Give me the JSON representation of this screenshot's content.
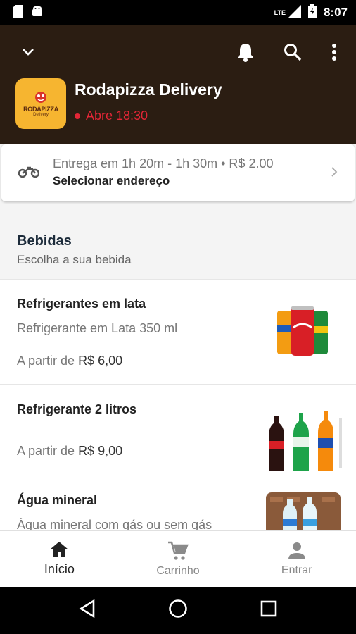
{
  "status_bar": {
    "time": "8:07",
    "network": "LTE"
  },
  "header": {
    "logo": {
      "brand": "RODAPIZZA",
      "sub": "Delivery"
    },
    "store_name": "Rodapizza Delivery",
    "status": "Abre 18:30"
  },
  "delivery": {
    "info": "Entrega em 1h 20m - 1h 30m • R$ 2.00",
    "action": "Selecionar endereço"
  },
  "section": {
    "title": "Bebidas",
    "subtitle": "Escolha a sua bebida"
  },
  "products": [
    {
      "title": "Refrigerantes em lata",
      "description": "Refrigerante em Lata 350 ml",
      "price_prefix": "A partir de",
      "price": "R$ 6,00"
    },
    {
      "title": "Refrigerante 2 litros",
      "description": "",
      "price_prefix": "A partir de",
      "price": "R$ 9,00"
    },
    {
      "title": "Água mineral",
      "description": "Água mineral com gás ou sem gás"
    }
  ],
  "bottom_nav": [
    {
      "label": "Início",
      "icon": "home-icon",
      "active": true
    },
    {
      "label": "Carrinho",
      "icon": "cart-icon",
      "active": false
    },
    {
      "label": "Entrar",
      "icon": "person-icon",
      "active": false
    }
  ],
  "colors": {
    "header_bg": "#2b1d12",
    "status_red": "#e32636",
    "logo_bg": "#f6b530"
  }
}
